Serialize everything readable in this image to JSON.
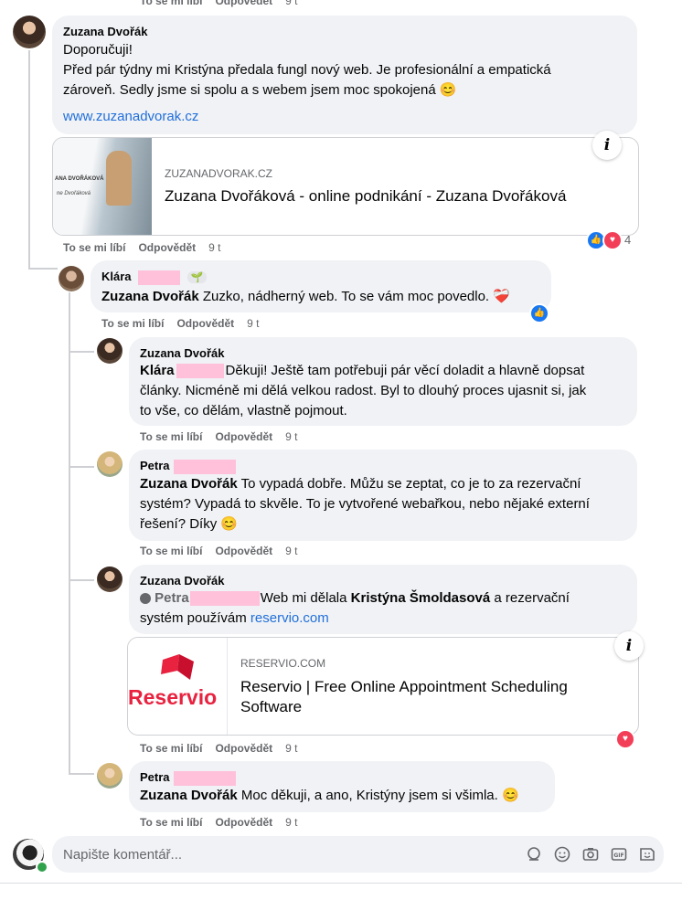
{
  "actions": {
    "like": "To se mi líbí",
    "reply": "Odpovědět",
    "time": "9 t"
  },
  "c1": {
    "author": "Zuzana Dvořák",
    "line1": "Doporučuji!",
    "line2": "Před pár týdny mi Kristýna předala fungl nový web. Je profesionální a empatická",
    "line3": "zároveň. Sedly jsme si spolu a s webem jsem moc spokojená 😊",
    "link": "www.zuzanadvorak.cz",
    "preview": {
      "domain": "ZUZANADVORAK.CZ",
      "title": "Zuzana Dvořáková - online podnikání - Zuzana Dvořáková",
      "thumb_text1": "ANA DVOŘÁKOVÁ",
      "thumb_text2": "ne Dvořáková"
    },
    "reaction_count": "4",
    "info": "i"
  },
  "c2": {
    "author": "Klára",
    "badge": "🌱",
    "mention": "Zuzana Dvořák",
    "text": "Zuzko, nádherný web. To se vám moc povedlo. ❤️‍🩹"
  },
  "c3": {
    "author": "Zuzana Dvořák",
    "mention": "Klára",
    "line1": "Děkuji! Ještě tam potřebuji pár věcí doladit a hlavně dopsat",
    "line2": "články. Nicméně mi dělá velkou radost. Byl to dlouhý proces ujasnit si, jak",
    "line3": "to vše, co dělám, vlastně pojmout."
  },
  "c4": {
    "author": "Petra",
    "mention": "Zuzana Dvořák",
    "line1": "To vypadá dobře. Můžu se zeptat, co je to za rezervační",
    "line2": "systém? Vypadá to skvěle. To je vytvořené webařkou, nebo nějaké externí",
    "line3": "řešení? Díky 😊"
  },
  "c5": {
    "author": "Zuzana Dvořák",
    "mention": "Petra",
    "text_a": "Web mi dělala",
    "bold_name": "Kristýna Šmoldasová",
    "text_b": "a rezervační",
    "line2": "systém používám",
    "link": "reservio.com",
    "preview": {
      "logo": "Reservio",
      "domain": "RESERVIO.COM",
      "title1": "Reservio | Free Online Appointment Scheduling",
      "title2": "Software"
    },
    "info": "i"
  },
  "c6": {
    "author": "Petra",
    "mention": "Zuzana Dvořák",
    "text": "Moc děkuji, a ano, Kristýny jsem si všimla. 😊"
  },
  "composer": {
    "placeholder": "Napište komentář..."
  },
  "colors": {
    "bubble": "#f0f2f5",
    "link": "#216fdb",
    "meta": "#65676b",
    "redact": "#ffc0d9",
    "like": "#1877f2",
    "love": "#f33e58"
  }
}
